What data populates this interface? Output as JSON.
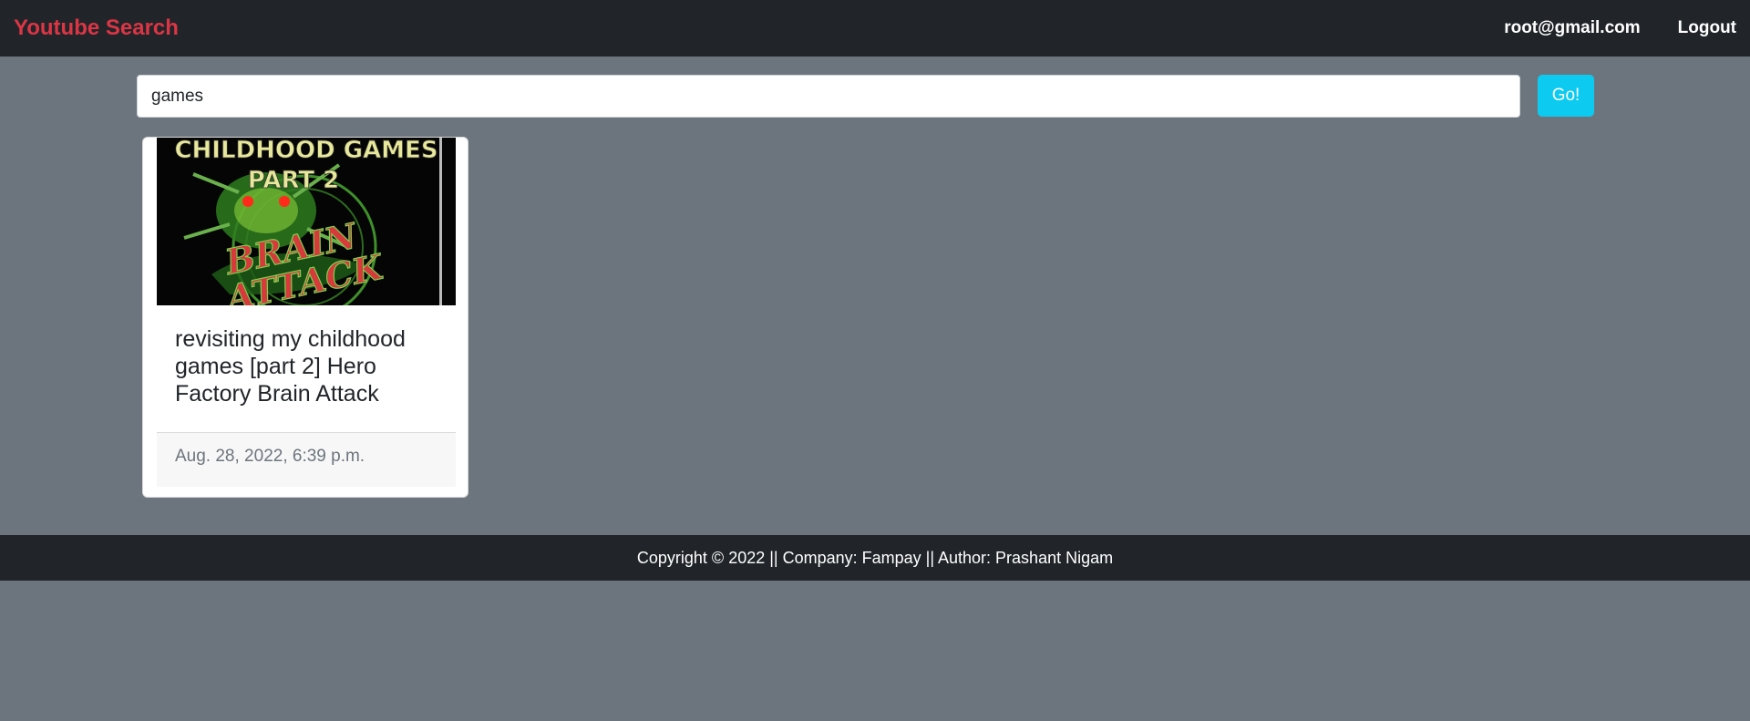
{
  "navbar": {
    "brand": "Youtube Search",
    "user_email": "root@gmail.com",
    "logout_label": "Logout",
    "brand_color": "#dc3545",
    "background": "#212529"
  },
  "search": {
    "value": "games",
    "button_label": "Go!",
    "button_color": "#0dcaf0"
  },
  "results": [
    {
      "thumbnail_text_line1": "CHILDHOOD GAMES",
      "thumbnail_text_line2": "PART 2",
      "thumbnail_text_line3": "BRAIN",
      "thumbnail_text_line4": "ATTACK",
      "title": "revisiting my childhood games [part 2] Hero Factory Brain Attack",
      "published": "Aug. 28, 2022, 6:39 p.m."
    }
  ],
  "footer": {
    "text": "Copyright © 2022 || Company: Fampay || Author: Prashant Nigam"
  },
  "colors": {
    "page_background": "#6c757d",
    "footer_background": "#212529"
  }
}
